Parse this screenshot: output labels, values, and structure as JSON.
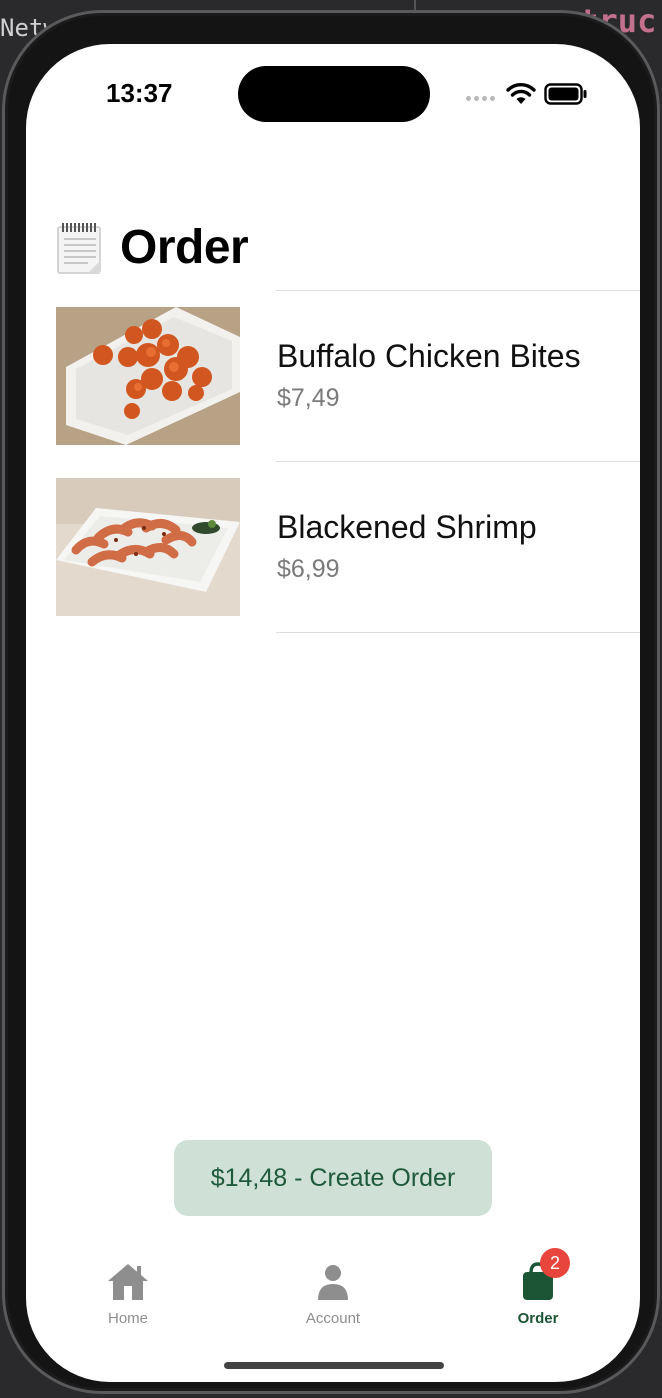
{
  "backdrop": {
    "left_text": "Netw",
    "right_text": "struc"
  },
  "status_bar": {
    "time": "13:37"
  },
  "header": {
    "title": "Order",
    "icon": "notepad-icon"
  },
  "order_items": [
    {
      "name": "Buffalo Chicken Bites",
      "price": "$7,49",
      "image": "buffalo-chicken-bites-photo"
    },
    {
      "name": "Blackened Shrimp",
      "price": "$6,99",
      "image": "blackened-shrimp-photo"
    }
  ],
  "create_order_button": {
    "label": "$14,48 - Create Order"
  },
  "tab_bar": {
    "tabs": [
      {
        "label": "Home",
        "icon": "house-icon",
        "active": false
      },
      {
        "label": "Account",
        "icon": "person-icon",
        "active": false
      },
      {
        "label": "Order",
        "icon": "bag-icon",
        "active": true,
        "badge": "2"
      }
    ]
  },
  "colors": {
    "accent": "#1c5535",
    "button_bg": "#cfe0d7",
    "badge": "#e8453c",
    "price_text": "#7a7a7a"
  }
}
